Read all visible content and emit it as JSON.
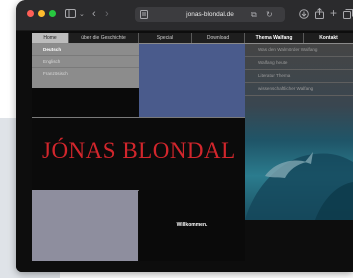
{
  "browser": {
    "url": "jonas-blondal.de",
    "traffic_lights": [
      "#ff5f57",
      "#febc2e",
      "#28c840"
    ]
  },
  "site": {
    "nav": [
      {
        "label": "Home"
      },
      {
        "label": "über die Geschichte"
      },
      {
        "label": "Special"
      },
      {
        "label": "Download"
      },
      {
        "label": "Thema Walfang"
      },
      {
        "label": "Kontakt"
      }
    ],
    "languages": [
      "Deutsch",
      "Englisch",
      "Französisch"
    ],
    "submenu": [
      "Was den Walmörder Walfang",
      "Walfang heute",
      "Literatur Thema",
      "wissenschaftlicher Walfang"
    ],
    "banner_title": "JÓNAS BLONDAL",
    "welcome": "Willkommen.",
    "colors": {
      "title_red": "#d2262c",
      "blue_block": "#4a5b8c",
      "nav_active": "#bcbcbc"
    }
  }
}
